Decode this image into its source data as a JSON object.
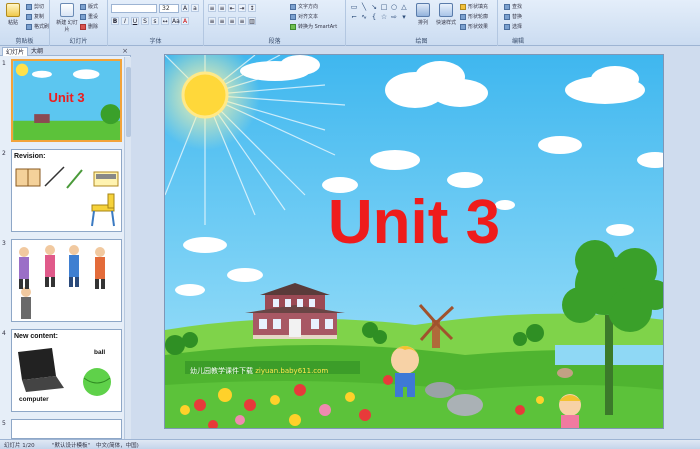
{
  "ribbon": {
    "clipboard": {
      "paste": "粘贴",
      "cut": "剪切",
      "copy": "复制",
      "format_painter": "格式刷",
      "label": "剪贴板"
    },
    "slides": {
      "new_slide": "新建\n幻灯片",
      "layout": "版式",
      "reset": "重设",
      "delete": "删除",
      "label": "幻灯片"
    },
    "font": {
      "font_name": "",
      "font_size": "32",
      "label": "字体"
    },
    "paragraph": {
      "text_direction": "文字方向",
      "align_text": "对齐文本",
      "smartart": "转换为 SmartArt",
      "label": "段落"
    },
    "drawing": {
      "arrange": "排列",
      "quick_styles": "快速样式",
      "shape_fill": "形状填充",
      "shape_outline": "形状轮廓",
      "shape_effects": "形状效果",
      "label": "绘图"
    },
    "editing": {
      "find": "查找",
      "replace": "替换",
      "select": "选择",
      "label": "编辑"
    }
  },
  "panel": {
    "tabs": [
      "幻灯片",
      "大纲"
    ],
    "slides": [
      {
        "number": "1",
        "title": "Unit 3"
      },
      {
        "number": "2",
        "title": "Revision:"
      },
      {
        "number": "3",
        "title": ""
      },
      {
        "number": "4",
        "title": "New content:",
        "labels": [
          "ball",
          "computer"
        ]
      },
      {
        "number": "5",
        "title": ""
      }
    ]
  },
  "slide": {
    "title": "Unit 3",
    "watermark_text": "幼儿园教学课件下载",
    "watermark_url": "ziyuan.baby611.com"
  },
  "status": {
    "slide_count": "幻灯片 1/20",
    "theme": "\"默认设计模板\"",
    "language": "中文(简体，中国)"
  },
  "colors": {
    "title": "#ee1c1c",
    "sky": "#5cc6f0",
    "grass": "#5cc23a",
    "selection": "#f2a33a"
  }
}
